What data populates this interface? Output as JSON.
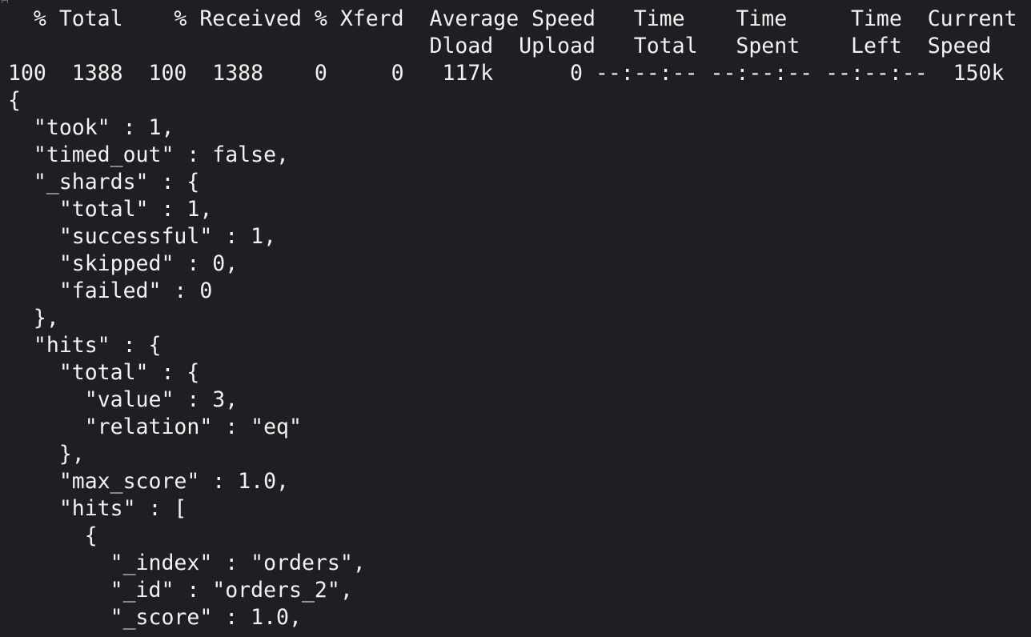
{
  "terminal": {
    "background": "#1e1f22",
    "foreground": "#f2f2f2",
    "lines": [
      "  % Total    % Received % Xferd  Average Speed   Time    Time     Time  Current",
      "                                 Dload  Upload   Total   Spent    Left  Speed",
      "100  1388  100  1388    0     0   117k      0 --:--:-- --:--:-- --:--:--  150k",
      "{",
      "  \"took\" : 1,",
      "  \"timed_out\" : false,",
      "  \"_shards\" : {",
      "    \"total\" : 1,",
      "    \"successful\" : 1,",
      "    \"skipped\" : 0,",
      "    \"failed\" : 0",
      "  },",
      "  \"hits\" : {",
      "    \"total\" : {",
      "      \"value\" : 3,",
      "      \"relation\" : \"eq\"",
      "    },",
      "    \"max_score\" : 1.0,",
      "    \"hits\" : [",
      "      {",
      "        \"_index\" : \"orders\",",
      "        \"_id\" : \"orders_2\",",
      "        \"_score\" : 1.0,"
    ]
  }
}
